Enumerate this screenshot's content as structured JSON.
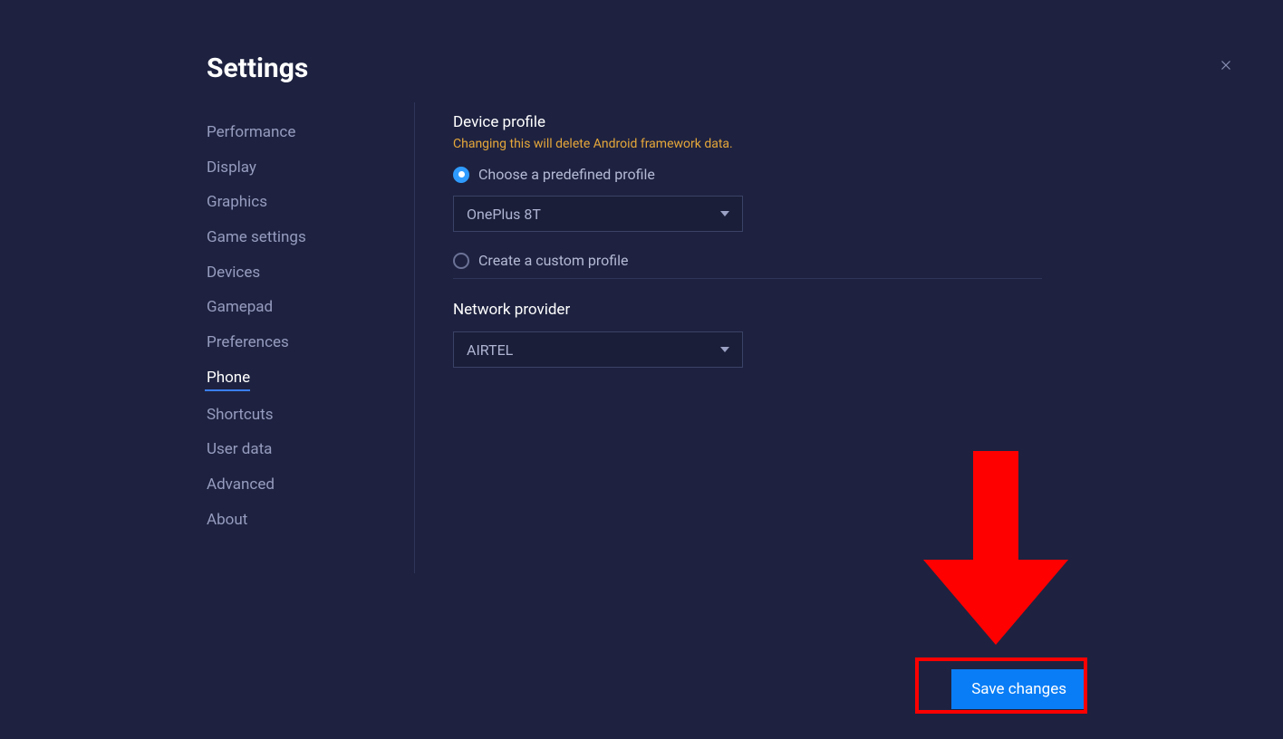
{
  "header": {
    "title": "Settings"
  },
  "sidebar": {
    "items": [
      {
        "label": "Performance",
        "key": "performance"
      },
      {
        "label": "Display",
        "key": "display"
      },
      {
        "label": "Graphics",
        "key": "graphics"
      },
      {
        "label": "Game settings",
        "key": "game-settings"
      },
      {
        "label": "Devices",
        "key": "devices"
      },
      {
        "label": "Gamepad",
        "key": "gamepad"
      },
      {
        "label": "Preferences",
        "key": "preferences"
      },
      {
        "label": "Phone",
        "key": "phone",
        "active": true
      },
      {
        "label": "Shortcuts",
        "key": "shortcuts"
      },
      {
        "label": "User data",
        "key": "user-data"
      },
      {
        "label": "Advanced",
        "key": "advanced"
      },
      {
        "label": "About",
        "key": "about"
      }
    ]
  },
  "phone": {
    "device_profile": {
      "title": "Device profile",
      "warning": "Changing this will delete Android framework data.",
      "option_predefined": "Choose a predefined profile",
      "option_custom": "Create a custom profile",
      "selected": "OnePlus 8T"
    },
    "network_provider": {
      "title": "Network provider",
      "selected": "AIRTEL"
    }
  },
  "footer": {
    "save_label": "Save changes"
  },
  "colors": {
    "background": "#1e2240",
    "accent": "#097df6",
    "warning": "#e5a73a",
    "annotation": "#ff0000"
  }
}
